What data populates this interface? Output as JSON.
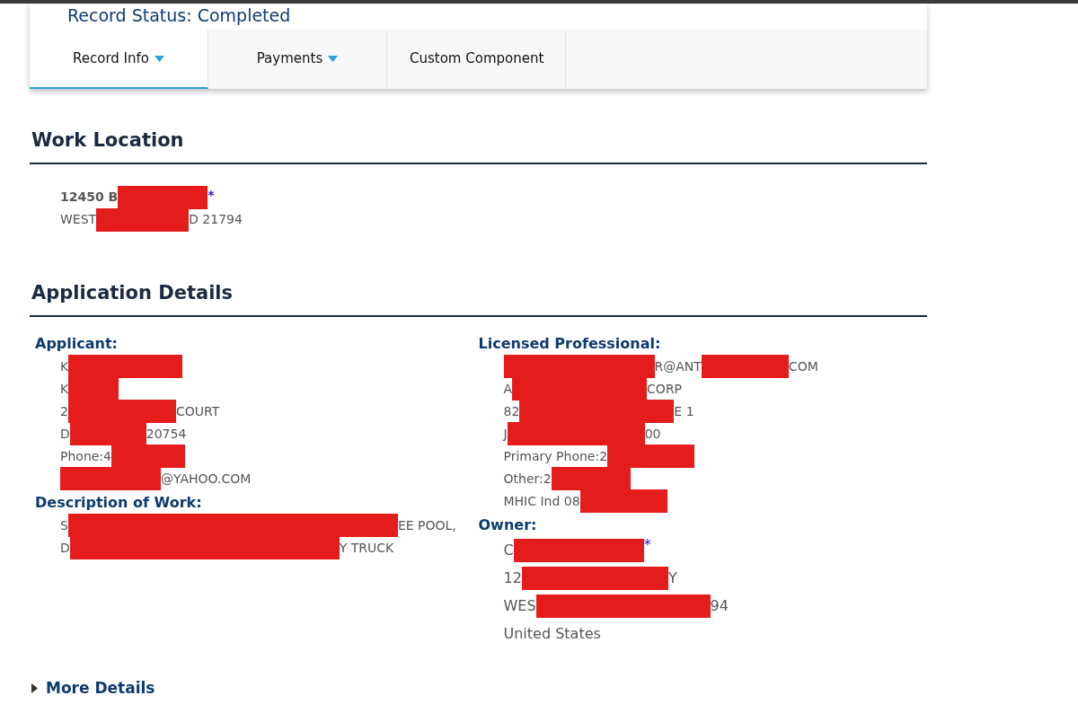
{
  "record_status": "Record Status: Completed",
  "tabs": [
    {
      "label": "Record Info",
      "dropdown": true,
      "selected": true
    },
    {
      "label": "Payments",
      "dropdown": true,
      "selected": false
    },
    {
      "label": "Custom Component",
      "dropdown": false,
      "selected": false
    }
  ],
  "work_location": {
    "title": "Work Location",
    "lines": [
      [
        {
          "kind": "text",
          "text": "12450 B"
        },
        {
          "kind": "redacted"
        },
        {
          "kind": "mark",
          "text": "*"
        }
      ],
      [
        {
          "kind": "text",
          "text": "WEST"
        },
        {
          "kind": "redacted"
        },
        {
          "kind": "text",
          "text": "D 21794"
        }
      ]
    ]
  },
  "application_details": {
    "title": "Application Details",
    "columns": [
      [
        {
          "title": "Applicant:",
          "lines": [
            [
              {
                "kind": "text",
                "text": "K"
              },
              {
                "kind": "redacted"
              }
            ],
            [
              {
                "kind": "text",
                "text": "K"
              },
              {
                "kind": "redacted"
              }
            ],
            [
              {
                "kind": "text",
                "text": "2"
              },
              {
                "kind": "redacted"
              },
              {
                "kind": "text",
                "text": "COURT"
              }
            ],
            [
              {
                "kind": "text",
                "text": "D"
              },
              {
                "kind": "redacted"
              },
              {
                "kind": "text",
                "text": " 20754"
              }
            ],
            [
              {
                "kind": "text",
                "text": "Phone:4"
              },
              {
                "kind": "redacted"
              }
            ],
            [
              {
                "kind": "redacted"
              },
              {
                "kind": "text",
                "text": "@YAHOO.COM"
              }
            ]
          ]
        },
        {
          "title": "Description of Work:",
          "lines": [
            [
              {
                "kind": "text",
                "text": "S"
              },
              {
                "kind": "redacted"
              },
              {
                "kind": "text",
                "text": "EE POOL,"
              }
            ],
            [
              {
                "kind": "text",
                "text": "D"
              },
              {
                "kind": "redacted"
              },
              {
                "kind": "text",
                "text": "Y TRUCK"
              }
            ]
          ]
        }
      ],
      [
        {
          "title": "Licensed Professional:",
          "lines": [
            [
              {
                "kind": "redacted"
              },
              {
                "kind": "text",
                "text": "R@ANT"
              },
              {
                "kind": "redacted"
              },
              {
                "kind": "text",
                "text": "COM"
              }
            ],
            [
              {
                "kind": "text",
                "text": "A"
              },
              {
                "kind": "redacted"
              },
              {
                "kind": "text",
                "text": "CORP"
              }
            ],
            [
              {
                "kind": "text",
                "text": "82"
              },
              {
                "kind": "redacted"
              },
              {
                "kind": "text",
                "text": "E 1"
              }
            ],
            [
              {
                "kind": "text",
                "text": "J"
              },
              {
                "kind": "redacted"
              },
              {
                "kind": "text",
                "text": "00"
              }
            ],
            [
              {
                "kind": "text",
                "text": "Primary Phone:2"
              },
              {
                "kind": "redacted"
              }
            ],
            [
              {
                "kind": "text",
                "text": "Other:2"
              },
              {
                "kind": "redacted"
              }
            ],
            [
              {
                "kind": "text",
                "text": "MHIC Ind 08"
              },
              {
                "kind": "redacted"
              }
            ]
          ]
        },
        {
          "title": "Owner:",
          "lines": [
            [
              {
                "kind": "text",
                "text": "C"
              },
              {
                "kind": "redacted"
              },
              {
                "kind": "mark",
                "text": "*"
              }
            ],
            [
              {
                "kind": "text",
                "text": "12"
              },
              {
                "kind": "redacted"
              },
              {
                "kind": "text",
                "text": "Y"
              }
            ],
            [
              {
                "kind": "text",
                "text": "WES"
              },
              {
                "kind": "redacted"
              },
              {
                "kind": "text",
                "text": "94"
              }
            ],
            [
              {
                "kind": "text",
                "text": "United States"
              }
            ]
          ]
        }
      ]
    ]
  },
  "more_details": {
    "label": "More Details",
    "expanded": false
  }
}
